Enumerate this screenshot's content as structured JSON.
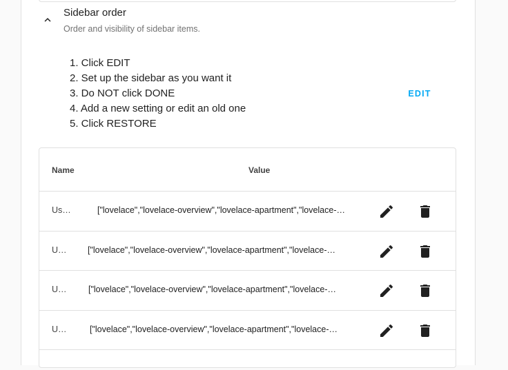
{
  "section": {
    "title": "Sidebar order",
    "subtitle": "Order and visibility of sidebar items.",
    "steps": [
      "1. Click EDIT",
      "2. Set up the sidebar as you want it",
      "3. Do NOT click DONE",
      "4. Add a new setting or edit an old one",
      "5. Click RESTORE"
    ],
    "edit_label": "EDIT"
  },
  "table": {
    "headers": {
      "name": "Name",
      "value": "Value"
    },
    "rows": [
      {
        "name": "Us…",
        "value": "[\"lovelace\",\"lovelace-overview\",\"lovelace-apartment\",\"lovelace-other\"]"
      },
      {
        "name": "U…",
        "value": "[\"lovelace\",\"lovelace-overview\",\"lovelace-apartment\",\"lovelace-other\"]"
      },
      {
        "name": "U…",
        "value": "[\"lovelace\",\"lovelace-overview\",\"lovelace-apartment\",\"lovelace-other\"]"
      },
      {
        "name": "U…",
        "value": "[\"lovelace\",\"lovelace-overview\",\"lovelace-apartment\",\"lovelace-other\"]"
      }
    ]
  },
  "icons": {
    "collapse": "chevron-up-icon",
    "edit": "pencil-icon",
    "delete": "trash-icon"
  },
  "colors": {
    "accent": "#03a9f4",
    "text": "#212121",
    "secondary_text": "#727272",
    "divider": "#e0e0e0"
  }
}
